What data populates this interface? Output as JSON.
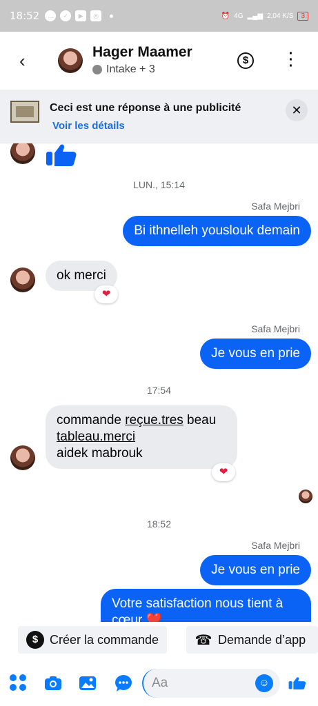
{
  "status_bar": {
    "time": "18:52",
    "network": "4G",
    "speed": "2,04\nK/S",
    "battery": "3"
  },
  "header": {
    "name": "Hager Maamer",
    "subtitle": "Intake + 3"
  },
  "ad_banner": {
    "title": "Ceci est une réponse à une publicité",
    "link": "Voir les détails"
  },
  "chat": {
    "separators": [
      "LUN., 15:14",
      "17:54",
      "18:52"
    ],
    "sender": "Safa Mejbri",
    "messages": {
      "m1": "Bi ithnelleh youslouk demain",
      "m2": "ok merci",
      "m3": "Je vous en prie",
      "m4_a": "commande ",
      "m4_b": "reçue.tres",
      "m4_c": " beau",
      "m4_d": "tableau.merci",
      "m4_e": "aidek mabrouk",
      "m5": "Je vous en prie",
      "m6": "Votre satisfaction nous tient à cœur ❤️"
    },
    "reaction": "❤"
  },
  "quick_actions": {
    "create_order": "Créer la commande",
    "request_appt": "Demande d’app"
  },
  "composer": {
    "placeholder": "Aa"
  },
  "colors": {
    "accent": "#0b63f6",
    "incoming": "#eaebee"
  }
}
